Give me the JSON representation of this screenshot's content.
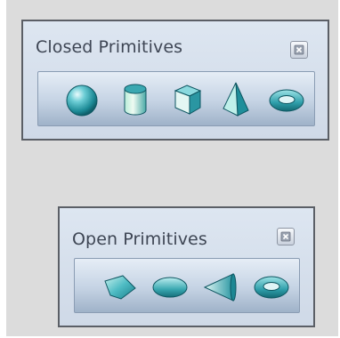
{
  "closed_toolbar": {
    "title": "Closed Primitives",
    "tools": [
      "sphere-icon",
      "cylinder-icon",
      "cube-icon",
      "cone-icon",
      "torus-icon"
    ]
  },
  "open_toolbar": {
    "title": "Open Primitives",
    "tools": [
      "open-plane-icon",
      "open-disk-icon",
      "open-cone-icon",
      "open-torus-icon"
    ]
  },
  "colors": {
    "panel_bg": "#dcdcdc",
    "toolbar_bg": "#d6dfeb",
    "toolbar_border": "#5b5f66",
    "icon_teal": "#3ba7b0"
  }
}
